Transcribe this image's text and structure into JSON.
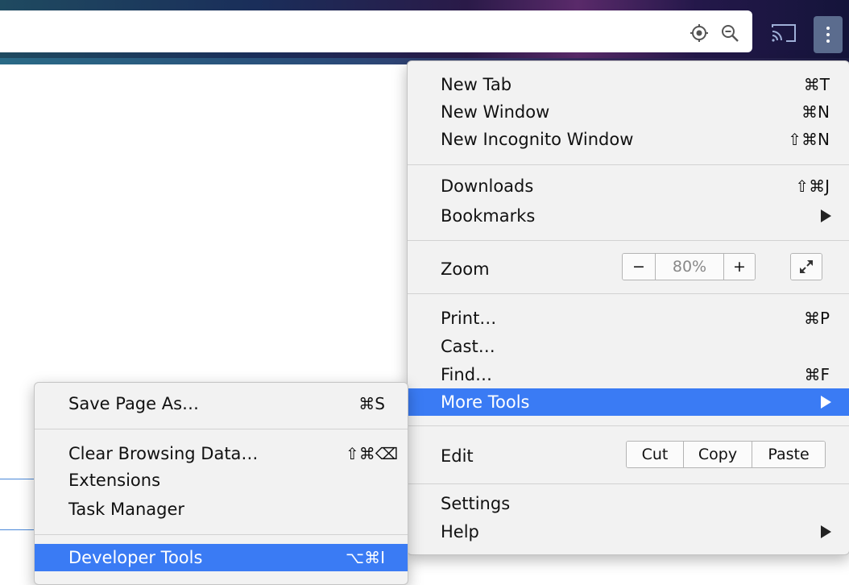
{
  "toolbar": {
    "location_icon": "crosshair-icon",
    "zoom_icon": "zoom-out-icon",
    "cast_icon": "cast-icon",
    "menu_icon": "kebab-menu-icon"
  },
  "main_menu": {
    "items": [
      {
        "label": "New Tab",
        "shortcut": "⌘T"
      },
      {
        "label": "New Window",
        "shortcut": "⌘N"
      },
      {
        "label": "New Incognito Window",
        "shortcut": "⇧⌘N"
      },
      {
        "label": "Downloads",
        "shortcut": "⇧⌘J"
      },
      {
        "label": "Bookmarks",
        "shortcut": ""
      },
      {
        "label": "Zoom",
        "shortcut": ""
      },
      {
        "label": "Print…",
        "shortcut": "⌘P"
      },
      {
        "label": "Cast…",
        "shortcut": ""
      },
      {
        "label": "Find…",
        "shortcut": "⌘F"
      },
      {
        "label": "More Tools",
        "shortcut": ""
      },
      {
        "label": "Edit",
        "shortcut": ""
      },
      {
        "label": "Settings",
        "shortcut": ""
      },
      {
        "label": "Help",
        "shortcut": ""
      }
    ],
    "zoom": {
      "minus": "−",
      "value": "80%",
      "plus": "+"
    },
    "edit": {
      "cut": "Cut",
      "copy": "Copy",
      "paste": "Paste"
    },
    "highlighted": "More Tools"
  },
  "sub_menu": {
    "items": [
      {
        "label": "Save Page As…",
        "shortcut": "⌘S"
      },
      {
        "label": "Clear Browsing Data…",
        "shortcut": "⇧⌘⌫"
      },
      {
        "label": "Extensions",
        "shortcut": ""
      },
      {
        "label": "Task Manager",
        "shortcut": ""
      },
      {
        "label": "Developer Tools",
        "shortcut": "⌥⌘I"
      }
    ],
    "highlighted": "Developer Tools"
  },
  "colors": {
    "highlight": "#3a7bf4",
    "menu_bg": "#f2f2f2"
  }
}
